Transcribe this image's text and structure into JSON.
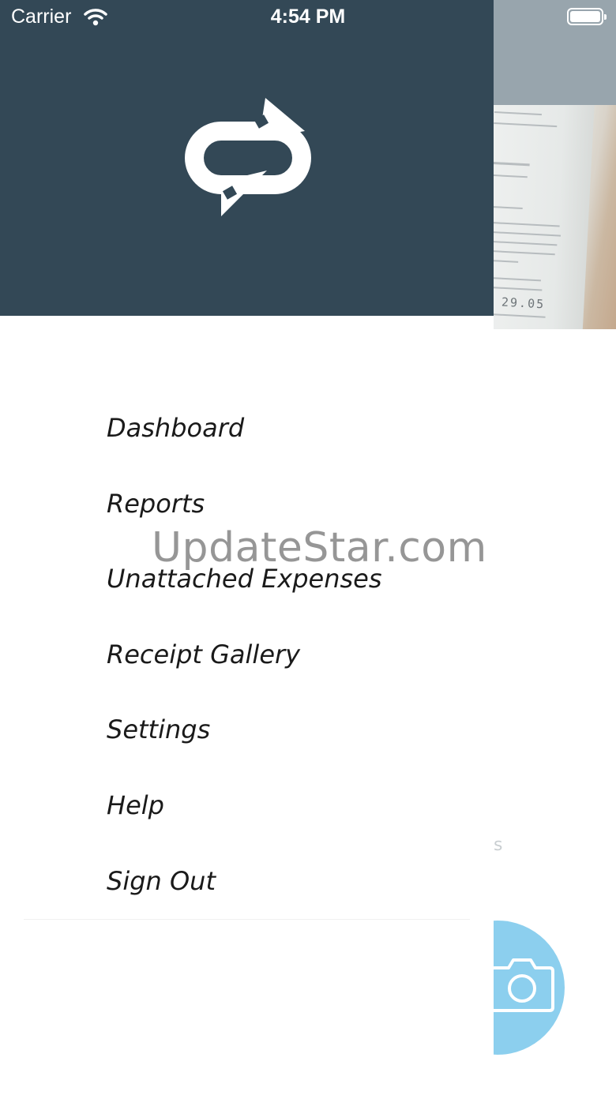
{
  "status_bar": {
    "carrier": "Carrier",
    "time": "4:54 PM",
    "wifi_icon": "wifi-icon",
    "battery_icon": "battery-icon"
  },
  "header": {
    "logo_icon": "sync-loop-icon",
    "background_color": "#334856"
  },
  "menu": {
    "items": [
      {
        "label": "Dashboard"
      },
      {
        "label": "Reports"
      },
      {
        "label": "Unattached Expenses"
      },
      {
        "label": "Receipt Gallery"
      },
      {
        "label": "Settings"
      },
      {
        "label": "Help"
      },
      {
        "label": "Sign Out"
      }
    ]
  },
  "background_app": {
    "receipt_total": "29.05",
    "fragment_text": "s",
    "camera_button_icon": "camera-icon",
    "accent_color": "#8ccfee"
  },
  "watermark": "UpdateStar.com"
}
